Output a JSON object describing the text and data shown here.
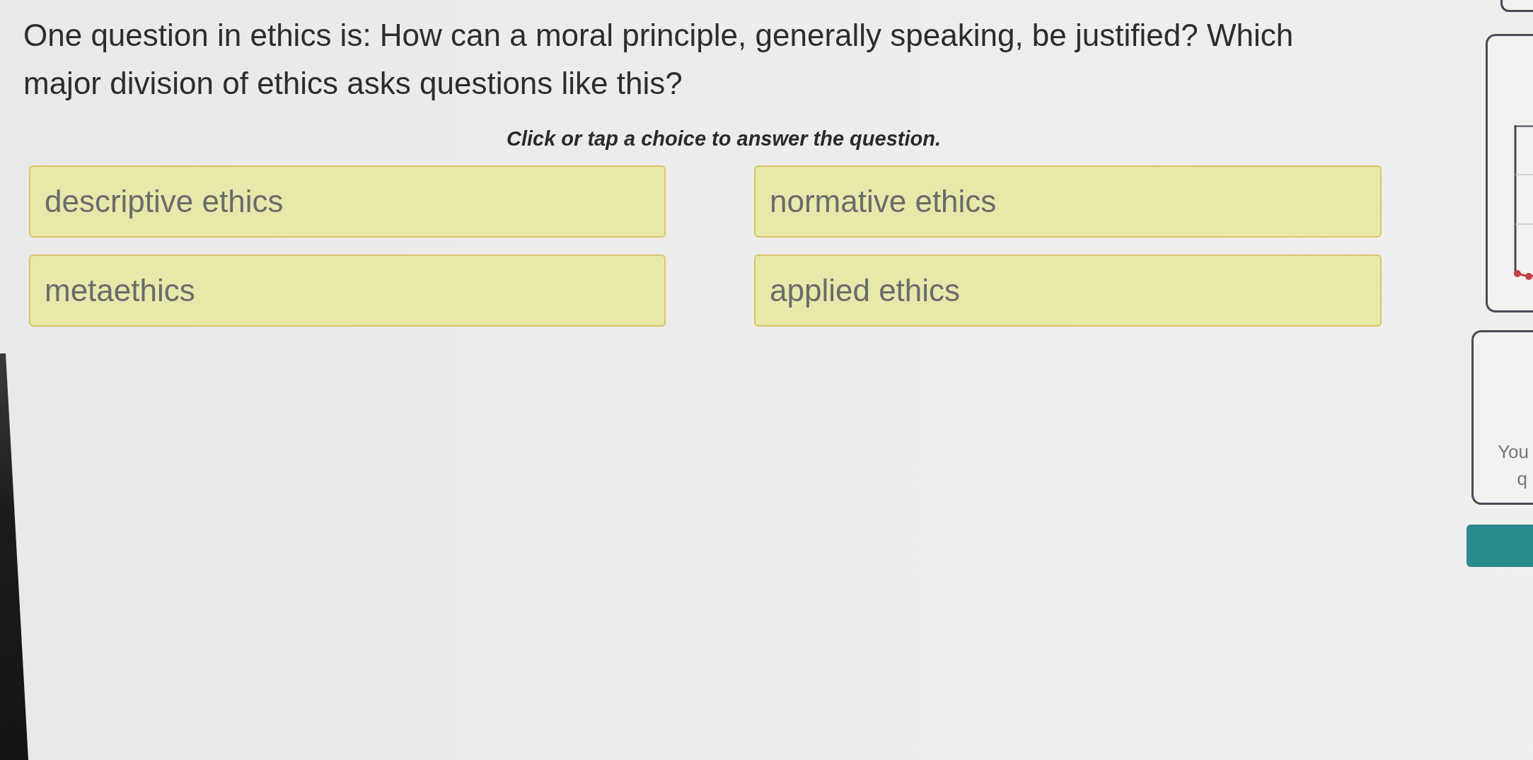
{
  "question": {
    "text": "One question in ethics is: How can a moral principle, generally speaking, be justified? Which major division of ethics asks questions like this?",
    "instruction": "Click or tap a choice to answer the question."
  },
  "choices": [
    {
      "label": "descriptive ethics",
      "selected": false
    },
    {
      "label": "normative ethics",
      "selected": false
    },
    {
      "label": "metaethics",
      "selected": false
    },
    {
      "label": "applied ethics",
      "selected": false
    }
  ],
  "side_panel": {
    "info_card": {
      "lines": [
        "You",
        "q"
      ]
    }
  }
}
